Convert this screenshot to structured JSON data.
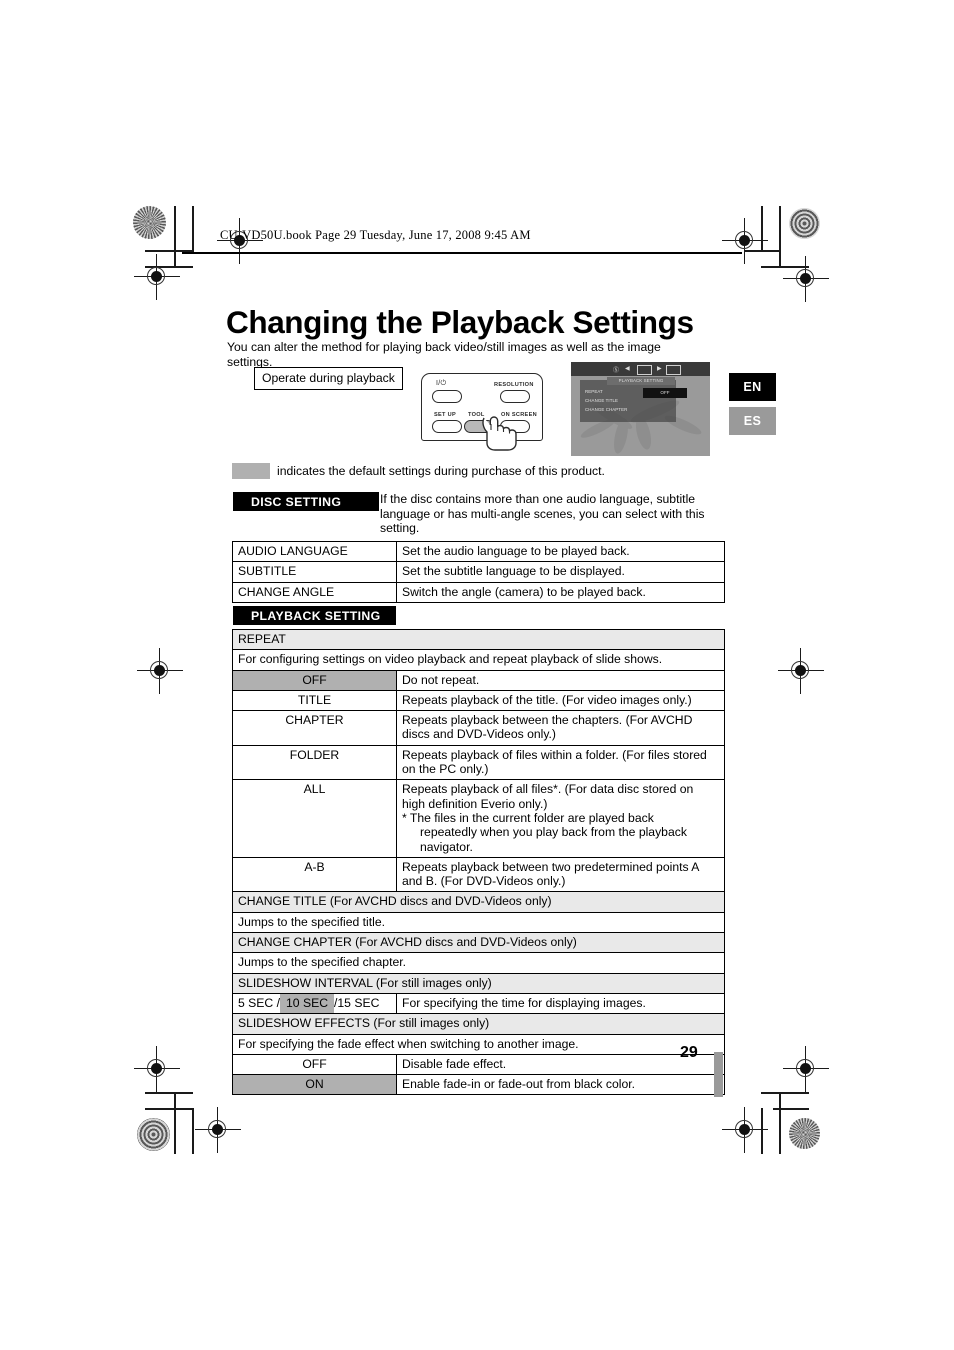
{
  "header": {
    "filepath": "CU-VD50U.book  Page 29  Tuesday, June 17, 2008  9:45 AM"
  },
  "page_title": "Changing the Playback Settings",
  "intro": "You can alter the method for playing back video/still images as well as the image settings.",
  "callout": "Operate during playback",
  "remote": {
    "power_label": "I/⏻",
    "resolution_label": "RESOLUTION",
    "setup_label": "SET UP",
    "tool_label": "TOOL",
    "onscreen_label": "ON SCREEN"
  },
  "tv_screen": {
    "menu_title": "PLAYBACK SETTING",
    "items": [
      "REPEAT",
      "CHANGE TITLE",
      "CHANGE CHAPTER"
    ],
    "value": "OFF"
  },
  "language_tabs": [
    {
      "label": "EN",
      "active": true,
      "color": "#000000"
    },
    {
      "label": "ES",
      "active": false,
      "color": "#9a9a9a"
    }
  ],
  "legend": {
    "text": "indicates the default settings during purchase of this product.",
    "swatch_color": "#b0b0b0"
  },
  "disc_setting": {
    "banner": "DISC SETTING",
    "description": "If the disc contains more than one audio language, subtitle language or has multi-angle scenes, you can select with this setting.",
    "rows": [
      {
        "name": "AUDIO LANGUAGE",
        "desc": "Set the audio language to be played back."
      },
      {
        "name": "SUBTITLE",
        "desc": "Set the subtitle language to be displayed."
      },
      {
        "name": "CHANGE ANGLE",
        "desc": "Switch the angle (camera) to be played back."
      }
    ]
  },
  "playback_setting": {
    "banner": "PLAYBACK SETTING",
    "repeat": {
      "header": "REPEAT",
      "description": "For configuring settings on video playback and repeat playback of slide shows.",
      "options": [
        {
          "name": "OFF",
          "desc": "Do not repeat.",
          "default": true
        },
        {
          "name": "TITLE",
          "desc": "Repeats playback of the title. (For video images only.)",
          "default": false
        },
        {
          "name": "CHAPTER",
          "desc": "Repeats playback between the chapters. (For AVCHD discs and DVD-Videos only.)",
          "default": false
        },
        {
          "name": "FOLDER",
          "desc": "Repeats playback of files within a folder. (For files stored on the PC only.)",
          "default": false
        },
        {
          "name": "ALL",
          "desc": "Repeats playback of all files*. (For data disc stored on high definition Everio only.)",
          "note": "* The files in the current folder are played back",
          "note2": "repeatedly when you play back from the playback",
          "note3": "navigator.",
          "default": false
        },
        {
          "name": "A-B",
          "desc": "Repeats playback between two predetermined points A and B. (For DVD-Videos only.)",
          "default": false
        }
      ]
    },
    "change_title": {
      "header": "CHANGE TITLE (For AVCHD discs and DVD-Videos only)",
      "description": "Jumps to the specified title."
    },
    "change_chapter": {
      "header": "CHANGE CHAPTER (For AVCHD discs and DVD-Videos only)",
      "description": "Jumps to the specified chapter."
    },
    "slideshow_interval": {
      "header": "SLIDESHOW INTERVAL (For still images only)",
      "option_prefix": "5 SEC /",
      "option_default": "10 SEC",
      "option_suffix": "/15 SEC",
      "desc": "For specifying the time for displaying images."
    },
    "slideshow_effects": {
      "header": "SLIDESHOW EFFECTS (For still images only)",
      "description": "For specifying the fade effect when switching to another image.",
      "options": [
        {
          "name": "OFF",
          "desc": "Disable fade effect.",
          "default": false
        },
        {
          "name": "ON",
          "desc": "Enable fade-in or fade-out from black color.",
          "default": true
        }
      ]
    }
  },
  "page_number": "29"
}
